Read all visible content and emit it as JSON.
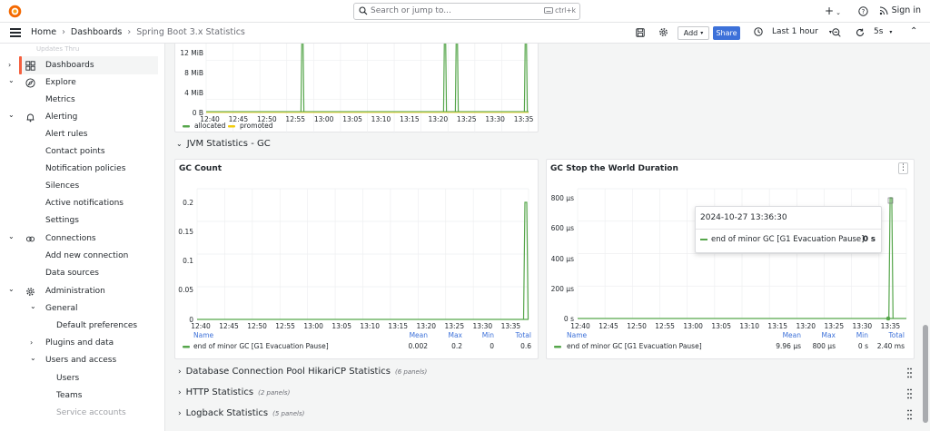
{
  "topbar": {
    "search_placeholder": "Search or jump to...",
    "search_shortcut": "ctrl+k",
    "add_icon": "plus-icon",
    "sign_in": "Sign in"
  },
  "navbar": {
    "breadcrumbs": [
      "Home",
      "Dashboards",
      "Spring Boot 3.x Statistics"
    ],
    "add_label": "Add",
    "share_label": "Share",
    "time_range": "Last 1 hour",
    "refresh_interval": "5s"
  },
  "sidebar": {
    "faded_text": "Updates Thru",
    "items": [
      {
        "label": "Dashboards",
        "icon": "dashboards-icon",
        "chevron": "right",
        "level": 0,
        "active": true
      },
      {
        "label": "Explore",
        "icon": "compass-icon",
        "chevron": "down",
        "level": 0
      },
      {
        "label": "Metrics",
        "level": 1
      },
      {
        "label": "Alerting",
        "icon": "bell-icon",
        "chevron": "down",
        "level": 0
      },
      {
        "label": "Alert rules",
        "level": 1
      },
      {
        "label": "Contact points",
        "level": 1
      },
      {
        "label": "Notification policies",
        "level": 1
      },
      {
        "label": "Silences",
        "level": 1
      },
      {
        "label": "Active notifications",
        "level": 1
      },
      {
        "label": "Settings",
        "level": 1
      },
      {
        "label": "Connections",
        "icon": "link-icon",
        "chevron": "down",
        "level": 0
      },
      {
        "label": "Add new connection",
        "level": 1
      },
      {
        "label": "Data sources",
        "level": 1
      },
      {
        "label": "Administration",
        "icon": "gear-icon",
        "chevron": "down",
        "level": 0
      },
      {
        "label": "General",
        "chevron": "down",
        "level": 1
      },
      {
        "label": "Default preferences",
        "level": 2
      },
      {
        "label": "Plugins and data",
        "chevron": "right",
        "level": 1
      },
      {
        "label": "Users and access",
        "chevron": "down",
        "level": 1
      },
      {
        "label": "Users",
        "level": 2
      },
      {
        "label": "Teams",
        "level": 2
      },
      {
        "label": "Service accounts",
        "level": 2
      }
    ]
  },
  "colors": {
    "green": "#56a64b",
    "yellow": "#f2cc0c",
    "accent": "#3d71d9",
    "active_bar": "#f55f3e"
  },
  "memory_panel": {
    "y_ticks": [
      "12 MiB",
      "8 MiB",
      "4 MiB",
      "0 B"
    ],
    "x_ticks": [
      "12:40",
      "12:45",
      "12:50",
      "12:55",
      "13:00",
      "13:05",
      "13:10",
      "13:15",
      "13:20",
      "13:25",
      "13:30",
      "13:35"
    ],
    "legend": [
      "allocated",
      "promoted"
    ]
  },
  "jvm_gc_row": {
    "title": "JVM Statistics - GC"
  },
  "gc_count": {
    "title": "GC Count",
    "y_ticks": [
      "0.2",
      "0.15",
      "0.1",
      "0.05",
      "0"
    ],
    "x_ticks": [
      "12:40",
      "12:45",
      "12:50",
      "12:55",
      "13:00",
      "13:05",
      "13:10",
      "13:15",
      "13:20",
      "13:25",
      "13:30",
      "13:35"
    ],
    "legend_headers": [
      "Name",
      "Mean",
      "Max",
      "Min",
      "Total"
    ],
    "series_name": "end of minor GC [G1 Evacuation Pause]",
    "stats": [
      "0.002",
      "0.2",
      "0",
      "0.6"
    ]
  },
  "gc_stw": {
    "title": "GC Stop the World Duration",
    "y_ticks": [
      "800 µs",
      "600 µs",
      "400 µs",
      "200 µs",
      "0 s"
    ],
    "x_ticks": [
      "12:40",
      "12:45",
      "12:50",
      "12:55",
      "13:00",
      "13:05",
      "13:10",
      "13:15",
      "13:20",
      "13:25",
      "13:30",
      "13:35"
    ],
    "legend_headers": [
      "Name",
      "Mean",
      "Max",
      "Min",
      "Total"
    ],
    "series_name": "end of minor GC [G1 Evacuation Pause]",
    "stats": [
      "9.96 µs",
      "800 µs",
      "0 s",
      "2.40 ms"
    ],
    "tooltip": {
      "time": "2024-10-27 13:36:30",
      "series": "end of minor GC [G1 Evacuation Pause]",
      "value": "0 s"
    }
  },
  "collapsed_rows": [
    {
      "title": "Database Connection Pool HikariCP Statistics",
      "count": "(6 panels)"
    },
    {
      "title": "HTTP Statistics",
      "count": "(2 panels)"
    },
    {
      "title": "Logback Statistics",
      "count": "(5 panels)"
    }
  ]
}
